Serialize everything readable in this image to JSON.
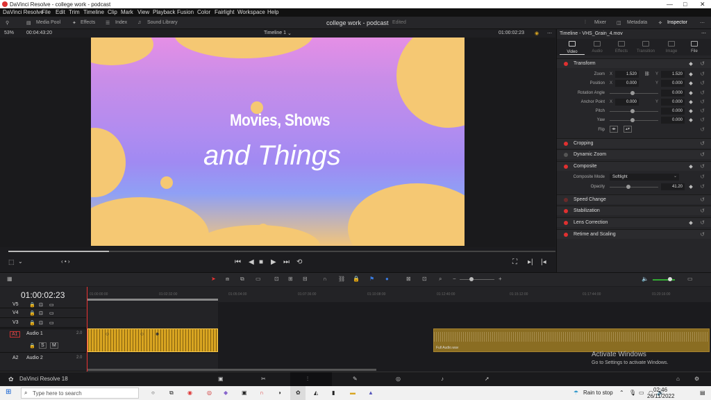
{
  "window": {
    "title": "DaVinci Resolve - college work - podcast"
  },
  "menu": [
    "DaVinci Resolve",
    "File",
    "Edit",
    "Trim",
    "Timeline",
    "Clip",
    "Mark",
    "View",
    "Playback",
    "Fusion",
    "Color",
    "Fairlight",
    "Workspace",
    "Help"
  ],
  "toolbar": {
    "media_pool": "Media Pool",
    "effects": "Effects",
    "index": "Index",
    "sound_library": "Sound Library",
    "project": "college work - podcast",
    "edited": "Edited",
    "mixer": "Mixer",
    "metadata": "Metadata",
    "inspector": "Inspector"
  },
  "viewer": {
    "zoom": "53%",
    "timecode_left": "00:04:43:20",
    "timeline_name": "Timeline 1",
    "timecode_right": "01:00:02:23",
    "title_line1": "Movies, Shows",
    "title_line2": "and Things"
  },
  "inspector": {
    "header": "Timeline - VHS_Grain_4.mov",
    "tabs": [
      "Video",
      "Audio",
      "Effects",
      "Transition",
      "Image",
      "File"
    ],
    "transform": {
      "label": "Transform",
      "zoom_label": "Zoom",
      "zoom_x": "1.520",
      "zoom_y": "1.520",
      "position_label": "Position",
      "position_x": "0.000",
      "position_y": "0.000",
      "rotation_label": "Rotation Angle",
      "rotation": "0.000",
      "anchor_label": "Anchor Point",
      "anchor_x": "0.000",
      "anchor_y": "0.000",
      "pitch_label": "Pitch",
      "pitch": "0.000",
      "yaw_label": "Yaw",
      "yaw": "0.000",
      "flip_label": "Flip"
    },
    "cropping": "Cropping",
    "dynamic_zoom": "Dynamic Zoom",
    "composite": {
      "label": "Composite",
      "mode_label": "Composite Mode",
      "mode": "Softlight",
      "opacity_label": "Opacity",
      "opacity": "41.20"
    },
    "speed_change": "Speed Change",
    "stabilization": "Stabilization",
    "lens_correction": "Lens Correction",
    "retime": "Retime and Scaling"
  },
  "timeline": {
    "timecode": "01:00:02:23",
    "ruler": [
      "01:00:00:00",
      "01:02:32:00",
      "01:05:04:00",
      "01:07:36:00",
      "01:10:08:00",
      "01:12:40:00",
      "01:15:12:00",
      "01:17:44:00",
      "01:20:16:00"
    ],
    "tracks": [
      {
        "id": "V5",
        "name": ""
      },
      {
        "id": "V4",
        "name": ""
      },
      {
        "id": "V3",
        "name": ""
      },
      {
        "id": "A1",
        "name": "Audio 1",
        "ch": "2.0"
      },
      {
        "id": "A2",
        "name": "Audio 2",
        "ch": "2.0"
      }
    ],
    "clip_label": "Full Audio.wav"
  },
  "footer": {
    "app": "DaVinci Resolve 18"
  },
  "watermark": {
    "line1": "Activate Windows",
    "line2": "Go to Settings to activate Windows."
  },
  "taskbar": {
    "search": "Type here to search",
    "weather": "Rain to stop",
    "time": "02:46",
    "date": "26/11/2022"
  }
}
